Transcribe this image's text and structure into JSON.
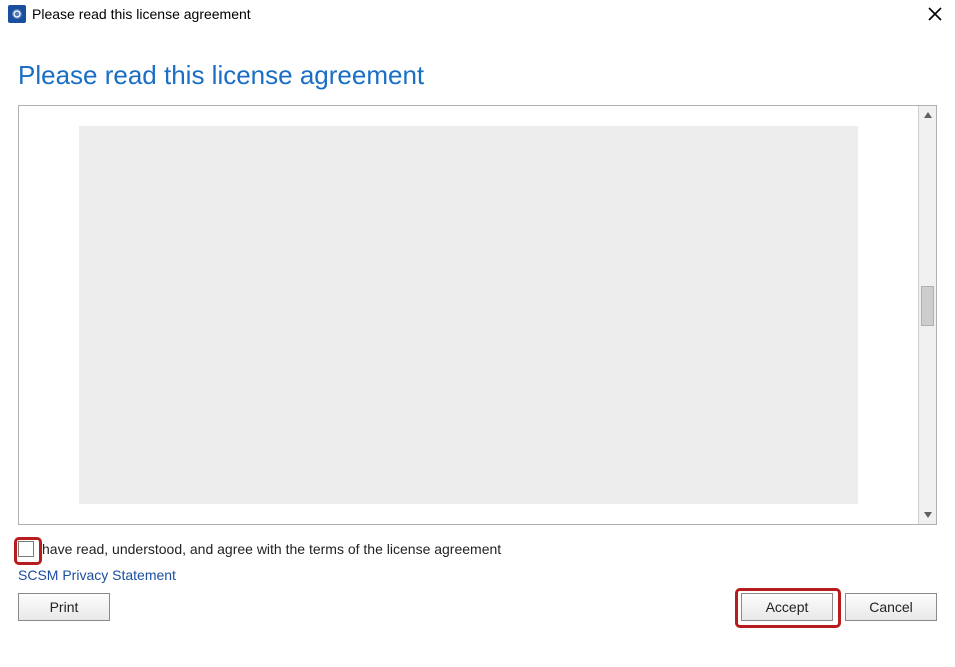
{
  "titlebar": {
    "text": "Please read this license agreement"
  },
  "heading": "Please read this license agreement",
  "checkbox": {
    "label": "have read, understood, and agree with the terms of the license agreement",
    "checked": false
  },
  "privacy_link": "SCSM Privacy Statement",
  "buttons": {
    "print": "Print",
    "accept": "Accept",
    "cancel": "Cancel"
  }
}
